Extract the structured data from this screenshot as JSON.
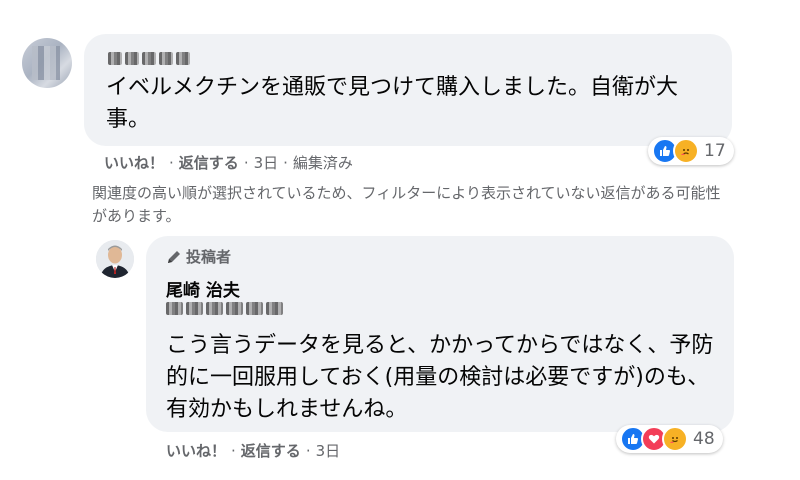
{
  "comments": [
    {
      "text": "イベルメクチンを通販で見つけて購入しました。自衛が大事。",
      "reaction_count": "17",
      "actions": {
        "like": "いいね！",
        "reply": "返信する",
        "time": "3日",
        "edited": "編集済み"
      }
    },
    {
      "author_badge": "投稿者",
      "author_name": "尾崎 治夫",
      "text": "こう言うデータを見ると、かかってからではなく、予防的に一回服用しておく(用量の検討は必要ですが)のも、有効かもしれませんね。",
      "reaction_count": "48",
      "actions": {
        "like": "いいね！",
        "reply": "返信する",
        "time": "3日"
      }
    }
  ],
  "filter_notice": "関連度の高い順が選択されているため、フィルターにより表示されていない返信がある可能性があります。",
  "icons": {
    "like": "like-icon",
    "love": "love-icon",
    "care": "care-icon",
    "author": "pencil-icon"
  },
  "colors": {
    "bubble": "#f0f2f5",
    "meta_text": "#65676b",
    "like_blue": "#1877f2",
    "love_red": "#f33e58",
    "care_yellow": "#f7b125"
  }
}
